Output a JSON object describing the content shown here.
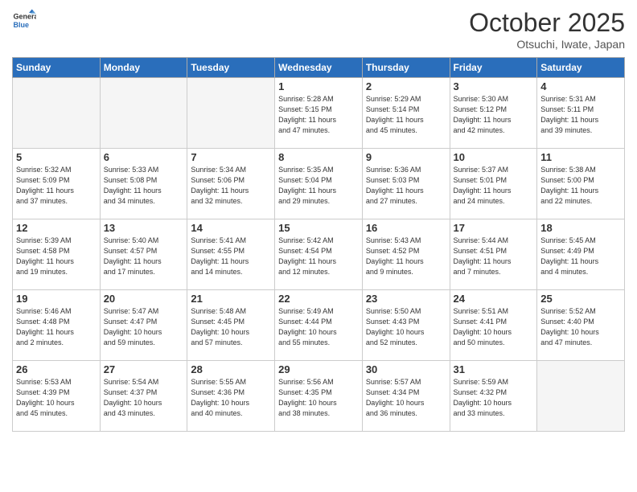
{
  "header": {
    "logo_line1": "General",
    "logo_line2": "Blue",
    "month": "October 2025",
    "location": "Otsuchi, Iwate, Japan"
  },
  "days_of_week": [
    "Sunday",
    "Monday",
    "Tuesday",
    "Wednesday",
    "Thursday",
    "Friday",
    "Saturday"
  ],
  "weeks": [
    [
      {
        "num": "",
        "info": ""
      },
      {
        "num": "",
        "info": ""
      },
      {
        "num": "",
        "info": ""
      },
      {
        "num": "1",
        "info": "Sunrise: 5:28 AM\nSunset: 5:15 PM\nDaylight: 11 hours\nand 47 minutes."
      },
      {
        "num": "2",
        "info": "Sunrise: 5:29 AM\nSunset: 5:14 PM\nDaylight: 11 hours\nand 45 minutes."
      },
      {
        "num": "3",
        "info": "Sunrise: 5:30 AM\nSunset: 5:12 PM\nDaylight: 11 hours\nand 42 minutes."
      },
      {
        "num": "4",
        "info": "Sunrise: 5:31 AM\nSunset: 5:11 PM\nDaylight: 11 hours\nand 39 minutes."
      }
    ],
    [
      {
        "num": "5",
        "info": "Sunrise: 5:32 AM\nSunset: 5:09 PM\nDaylight: 11 hours\nand 37 minutes."
      },
      {
        "num": "6",
        "info": "Sunrise: 5:33 AM\nSunset: 5:08 PM\nDaylight: 11 hours\nand 34 minutes."
      },
      {
        "num": "7",
        "info": "Sunrise: 5:34 AM\nSunset: 5:06 PM\nDaylight: 11 hours\nand 32 minutes."
      },
      {
        "num": "8",
        "info": "Sunrise: 5:35 AM\nSunset: 5:04 PM\nDaylight: 11 hours\nand 29 minutes."
      },
      {
        "num": "9",
        "info": "Sunrise: 5:36 AM\nSunset: 5:03 PM\nDaylight: 11 hours\nand 27 minutes."
      },
      {
        "num": "10",
        "info": "Sunrise: 5:37 AM\nSunset: 5:01 PM\nDaylight: 11 hours\nand 24 minutes."
      },
      {
        "num": "11",
        "info": "Sunrise: 5:38 AM\nSunset: 5:00 PM\nDaylight: 11 hours\nand 22 minutes."
      }
    ],
    [
      {
        "num": "12",
        "info": "Sunrise: 5:39 AM\nSunset: 4:58 PM\nDaylight: 11 hours\nand 19 minutes."
      },
      {
        "num": "13",
        "info": "Sunrise: 5:40 AM\nSunset: 4:57 PM\nDaylight: 11 hours\nand 17 minutes."
      },
      {
        "num": "14",
        "info": "Sunrise: 5:41 AM\nSunset: 4:55 PM\nDaylight: 11 hours\nand 14 minutes."
      },
      {
        "num": "15",
        "info": "Sunrise: 5:42 AM\nSunset: 4:54 PM\nDaylight: 11 hours\nand 12 minutes."
      },
      {
        "num": "16",
        "info": "Sunrise: 5:43 AM\nSunset: 4:52 PM\nDaylight: 11 hours\nand 9 minutes."
      },
      {
        "num": "17",
        "info": "Sunrise: 5:44 AM\nSunset: 4:51 PM\nDaylight: 11 hours\nand 7 minutes."
      },
      {
        "num": "18",
        "info": "Sunrise: 5:45 AM\nSunset: 4:49 PM\nDaylight: 11 hours\nand 4 minutes."
      }
    ],
    [
      {
        "num": "19",
        "info": "Sunrise: 5:46 AM\nSunset: 4:48 PM\nDaylight: 11 hours\nand 2 minutes."
      },
      {
        "num": "20",
        "info": "Sunrise: 5:47 AM\nSunset: 4:47 PM\nDaylight: 10 hours\nand 59 minutes."
      },
      {
        "num": "21",
        "info": "Sunrise: 5:48 AM\nSunset: 4:45 PM\nDaylight: 10 hours\nand 57 minutes."
      },
      {
        "num": "22",
        "info": "Sunrise: 5:49 AM\nSunset: 4:44 PM\nDaylight: 10 hours\nand 55 minutes."
      },
      {
        "num": "23",
        "info": "Sunrise: 5:50 AM\nSunset: 4:43 PM\nDaylight: 10 hours\nand 52 minutes."
      },
      {
        "num": "24",
        "info": "Sunrise: 5:51 AM\nSunset: 4:41 PM\nDaylight: 10 hours\nand 50 minutes."
      },
      {
        "num": "25",
        "info": "Sunrise: 5:52 AM\nSunset: 4:40 PM\nDaylight: 10 hours\nand 47 minutes."
      }
    ],
    [
      {
        "num": "26",
        "info": "Sunrise: 5:53 AM\nSunset: 4:39 PM\nDaylight: 10 hours\nand 45 minutes."
      },
      {
        "num": "27",
        "info": "Sunrise: 5:54 AM\nSunset: 4:37 PM\nDaylight: 10 hours\nand 43 minutes."
      },
      {
        "num": "28",
        "info": "Sunrise: 5:55 AM\nSunset: 4:36 PM\nDaylight: 10 hours\nand 40 minutes."
      },
      {
        "num": "29",
        "info": "Sunrise: 5:56 AM\nSunset: 4:35 PM\nDaylight: 10 hours\nand 38 minutes."
      },
      {
        "num": "30",
        "info": "Sunrise: 5:57 AM\nSunset: 4:34 PM\nDaylight: 10 hours\nand 36 minutes."
      },
      {
        "num": "31",
        "info": "Sunrise: 5:59 AM\nSunset: 4:32 PM\nDaylight: 10 hours\nand 33 minutes."
      },
      {
        "num": "",
        "info": ""
      }
    ]
  ]
}
